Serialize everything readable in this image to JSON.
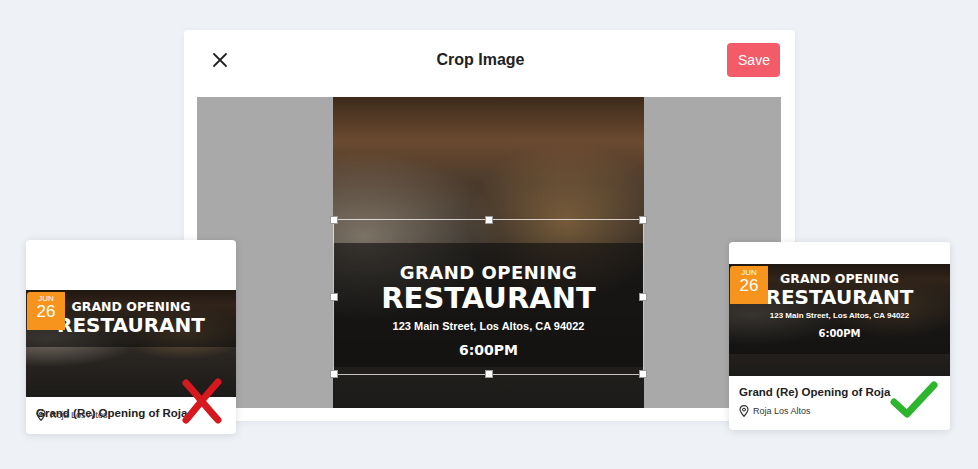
{
  "modal": {
    "title": "Crop Image",
    "save": "Save"
  },
  "flyer": {
    "heading": "GRAND OPENING",
    "name": "RESTAURANT",
    "address": "123 Main Street, Los Altos, CA 94022",
    "time": "6:00PM"
  },
  "cards": [
    {
      "month": "JUN",
      "day": "26",
      "title": "Grand (Re) Opening of Roja",
      "location": "Roja Los Altos",
      "correct": false
    },
    {
      "month": "JUN",
      "day": "26",
      "title": "Grand (Re) Opening of Roja",
      "location": "Roja Los Altos",
      "correct": true
    }
  ]
}
